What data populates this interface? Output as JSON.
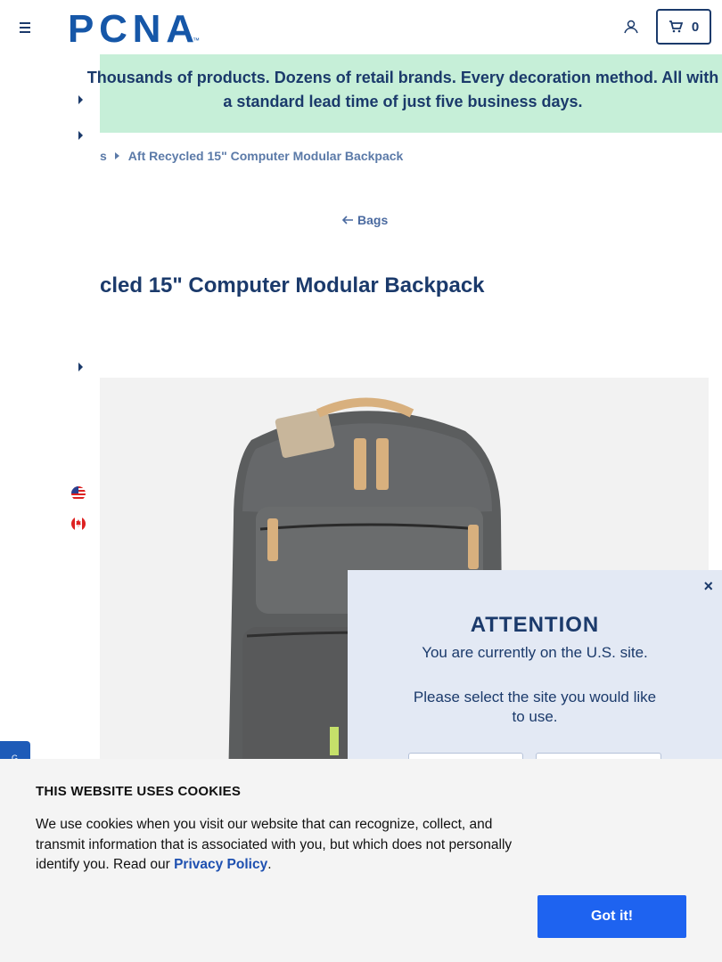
{
  "header": {
    "logo_text": "PCNA",
    "cart_count": "0"
  },
  "banner": {
    "text": "Thousands of products. Dozens of retail brands. Every decoration method. All with a standard lead time of just five business days."
  },
  "breadcrumb": {
    "items": [
      "s",
      "Aft Recycled 15\" Computer Modular Backpack"
    ]
  },
  "back_link": {
    "label": "Bags"
  },
  "product": {
    "title": "cled 15\" Computer Modular Backpack"
  },
  "side_tab": {
    "label": "G"
  },
  "modal": {
    "close": "×",
    "title": "ATTENTION",
    "message": "You are currently on the U.S. site.",
    "prompt": "Please select the site you would like to use."
  },
  "cookie": {
    "title": "THIS WEBSITE USES COOKIES",
    "text": "We use cookies when you visit our website that can recognize, collect, and transmit information that is associated with you, but which does not personally identify you. Read our ",
    "link": "Privacy Policy",
    "text_end": ".",
    "button": "Got it!"
  }
}
